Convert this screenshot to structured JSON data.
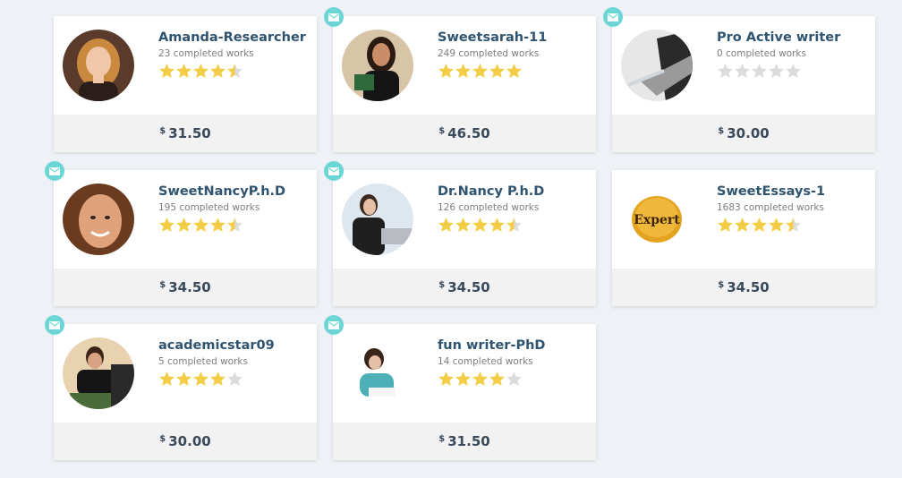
{
  "writers": [
    {
      "name": "Amanda-Researcher",
      "works": "23 completed works",
      "rating": 4.5,
      "currency": "$",
      "price": "31.50",
      "has_mail": false,
      "avatar": "woman-portrait-blonde"
    },
    {
      "name": "Sweetsarah-11",
      "works": "249 completed works",
      "rating": 5,
      "currency": "$",
      "price": "46.50",
      "has_mail": true,
      "avatar": "woman-with-book"
    },
    {
      "name": "Pro Active writer",
      "works": "0 completed works",
      "rating": 0,
      "currency": "$",
      "price": "30.00",
      "has_mail": true,
      "avatar": "pen-on-laptop"
    },
    {
      "name": "SweetNancyP.h.D",
      "works": "195 completed works",
      "rating": 4.5,
      "currency": "$",
      "price": "34.50",
      "has_mail": true,
      "avatar": "smiling-woman"
    },
    {
      "name": "Dr.Nancy P.h.D",
      "works": "126 completed works",
      "rating": 4.5,
      "currency": "$",
      "price": "34.50",
      "has_mail": true,
      "avatar": "woman-at-laptop"
    },
    {
      "name": "SweetEssays-1",
      "works": "1683 completed works",
      "rating": 4.5,
      "currency": "$",
      "price": "34.50",
      "has_mail": false,
      "avatar": "expert-badge",
      "avatar_text": "Expert"
    },
    {
      "name": "academicstar09",
      "works": "5 completed works",
      "rating": 4,
      "currency": "$",
      "price": "30.00",
      "has_mail": true,
      "avatar": "man-writing"
    },
    {
      "name": "fun writer-PhD",
      "works": "14 completed works",
      "rating": 4,
      "currency": "$",
      "price": "31.50",
      "has_mail": true,
      "avatar": "woman-reading"
    }
  ],
  "colors": {
    "star_filled": "#f2cd45",
    "star_empty": "#dcdcdc",
    "mail_badge": "#6bd6d6",
    "name": "#2f5470"
  }
}
